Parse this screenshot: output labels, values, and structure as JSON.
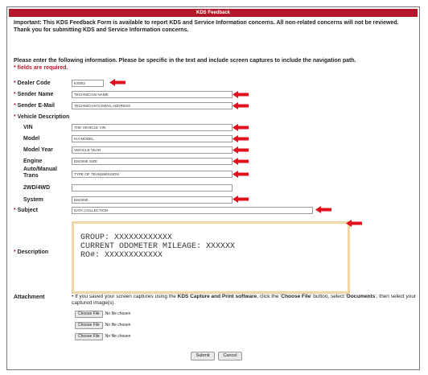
{
  "window": {
    "title": "KDS Feedback"
  },
  "intro": {
    "line1": "Important: This KDS Feedback Form is available to report KDS and Service Information concerns. All non-related concerns will not be reviewed.",
    "line2": "Thank you for submitting KDS and Service Information concerns."
  },
  "instructions": {
    "line1": "Please enter the following information. Please be specific in the text and include screen captures to include the navigation path.",
    "required": "* fields are required."
  },
  "form": {
    "dealer_code": {
      "label": "Dealer Code",
      "value": "ks003"
    },
    "sender_name": {
      "label": "Sender Name",
      "value": "TECHNICIAN NAME"
    },
    "sender_email": {
      "label": "Sender E-Mail",
      "value": "TECHNICIAN'S EMAIL ADDRESS"
    },
    "vehicle_description": {
      "label": "Vehicle Description"
    },
    "vin": {
      "label": "VIN",
      "value": "THE VEHICLE VIN"
    },
    "model": {
      "label": "Model",
      "value": "KIA MODEL"
    },
    "model_year": {
      "label": "Model Year",
      "value": "VEHICLE YEAR"
    },
    "engine": {
      "label": "Engine",
      "value": "ENGINE SIZE"
    },
    "trans": {
      "label_line1": "Auto/Manual",
      "label_line2": "Trans",
      "value": "TYPE OF TRANSMISSION"
    },
    "drive": {
      "label": "2WD/4WD",
      "value": ""
    },
    "system": {
      "label": "System",
      "value": "ENGINE"
    },
    "subject": {
      "label": "Subject",
      "value": "DATA COLLECTION"
    },
    "description": {
      "label": "Description",
      "lines": [
        "GROUP: XXXXXXXXXXXX",
        "CURRENT ODOMETER MILEAGE: XXXXXX",
        "RO#: XXXXXXXXXXXX"
      ]
    },
    "attachment": {
      "label": "Attachment",
      "text_before": "If you saved your screen captures using the ",
      "software": "KDS Capture and Print software",
      "text_mid": ", click the '",
      "choose_file": "Choose File",
      "text_mid2": "' button, select '",
      "documents": "Documents",
      "text_after": "', then select your captured image(s).",
      "files": [
        {
          "button": "Choose File",
          "status": "No file chosen"
        },
        {
          "button": "Choose File",
          "status": "No file chosen"
        },
        {
          "button": "Choose File",
          "status": "No file chosen"
        }
      ]
    }
  },
  "buttons": {
    "submit": "Submit",
    "cancel": "Cancel"
  },
  "colors": {
    "accent": "#b3182a",
    "arrow": "#e0101c",
    "description_border": "#efd7a6"
  },
  "icons": {
    "arrow": "left-arrow-icon"
  }
}
